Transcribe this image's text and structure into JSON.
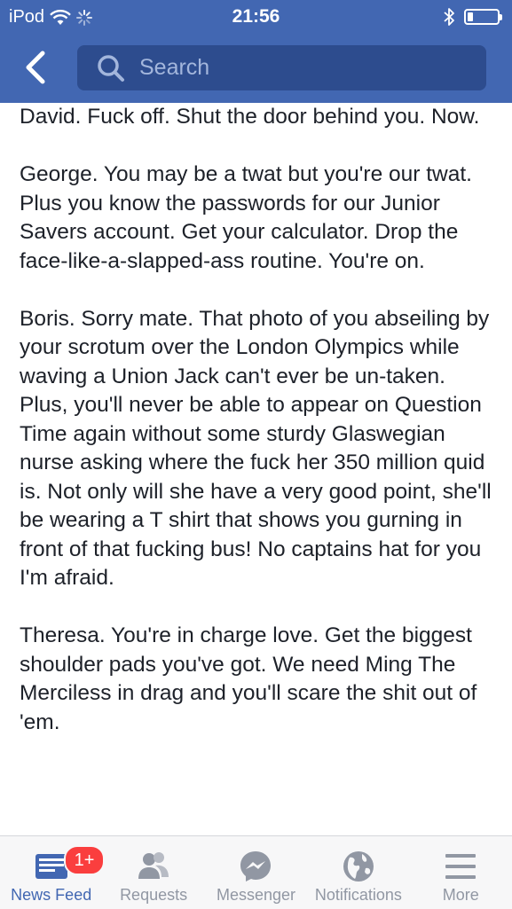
{
  "status_bar": {
    "carrier": "iPod",
    "time": "21:56",
    "battery_level": 0.18
  },
  "nav": {
    "search_placeholder": "Search"
  },
  "post": {
    "paragraphs": [
      "David. Fuck off. Shut the door behind you. Now.",
      "George. You may be a twat but you're our twat. Plus you know the passwords for our Junior Savers account. Get your calculator. Drop the face-like-a-slapped-ass routine. You're on.",
      "Boris. Sorry mate. That photo of you abseiling by your scrotum over the London Olympics while waving a Union Jack can't ever be un-taken. Plus, you'll never be able to appear on Question Time again without some sturdy Glaswegian nurse asking where the fuck her 350 million quid is. Not only will she have a very good point, she'll be wearing a T shirt that shows you gurning in front of that fucking bus! No captains hat for you I'm afraid.",
      "Theresa. You're in charge love. Get the biggest shoulder pads you've got. We need Ming The Merciless in drag and you'll scare the shit out of 'em."
    ]
  },
  "tabs": {
    "news_feed": {
      "label": "News Feed",
      "badge": "1+",
      "icon": "news-feed-icon"
    },
    "requests": {
      "label": "Requests",
      "icon": "friends-icon"
    },
    "messenger": {
      "label": "Messenger",
      "icon": "messenger-icon"
    },
    "notifications": {
      "label": "Notifications",
      "icon": "globe-icon"
    },
    "more": {
      "label": "More",
      "icon": "menu-icon"
    }
  },
  "colors": {
    "brand": "#4267b2",
    "search_bg": "#2d4c8e",
    "badge": "#fa3e3e",
    "tab_inactive": "#9197a3",
    "text": "#1d2129"
  }
}
